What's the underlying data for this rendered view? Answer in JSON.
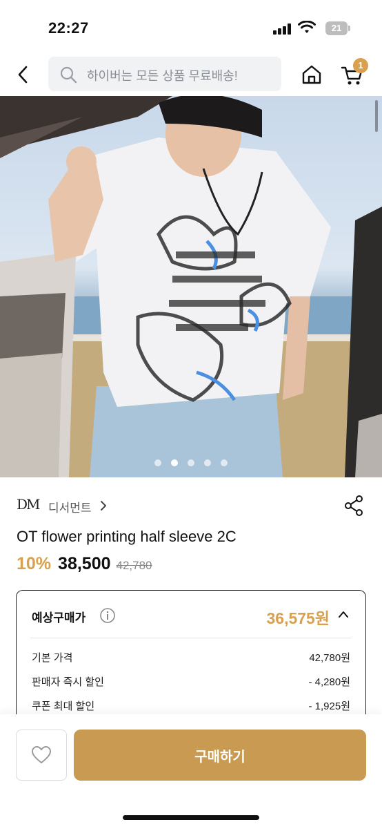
{
  "status_bar": {
    "time": "22:27",
    "battery_level": "21"
  },
  "header": {
    "search_placeholder": "하이버는 모든 상품 무료배송!",
    "cart_count": "1"
  },
  "gallery": {
    "image_count": 5,
    "active_index": 1
  },
  "product": {
    "brand_logo": "DM",
    "brand_name": "디서먼트",
    "title": "OT flower printing half sleeve 2C",
    "discount": "10%",
    "price": "38,500",
    "original_price": "42,780"
  },
  "expected_price": {
    "title": "예상구매가",
    "total": "36,575원",
    "rows": [
      {
        "label": "기본 가격",
        "value": "42,780원"
      },
      {
        "label": "판매자 즉시 할인",
        "value": "- 4,280원"
      },
      {
        "label": "쿠폰 최대 할인",
        "value": "- 1,925원"
      }
    ]
  },
  "bottom_bar": {
    "buy_label": "구매하기"
  },
  "colors": {
    "accent": "#d9a04e",
    "buy_button": "#c99a51"
  },
  "icons": {
    "back": "chevron-left-icon",
    "search": "search-icon",
    "home": "home-icon",
    "cart": "cart-icon",
    "share": "share-icon",
    "info": "info-icon",
    "collapse": "chevron-up-icon",
    "wishlist": "heart-icon"
  }
}
